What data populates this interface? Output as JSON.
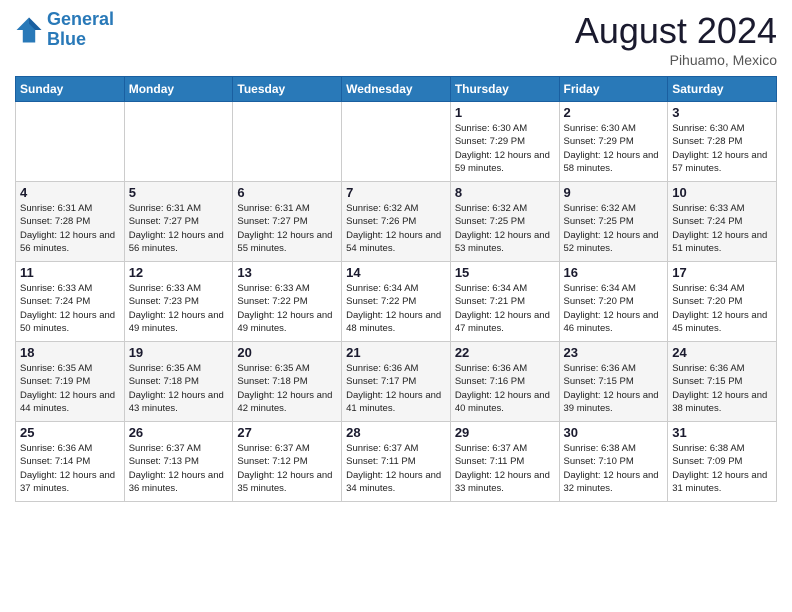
{
  "header": {
    "logo_line1": "General",
    "logo_line2": "Blue",
    "month_year": "August 2024",
    "location": "Pihuamo, Mexico"
  },
  "days_header": [
    "Sunday",
    "Monday",
    "Tuesday",
    "Wednesday",
    "Thursday",
    "Friday",
    "Saturday"
  ],
  "weeks": [
    [
      {
        "day": "",
        "sunrise": "",
        "sunset": "",
        "daylight": ""
      },
      {
        "day": "",
        "sunrise": "",
        "sunset": "",
        "daylight": ""
      },
      {
        "day": "",
        "sunrise": "",
        "sunset": "",
        "daylight": ""
      },
      {
        "day": "",
        "sunrise": "",
        "sunset": "",
        "daylight": ""
      },
      {
        "day": "1",
        "sunrise": "Sunrise: 6:30 AM",
        "sunset": "Sunset: 7:29 PM",
        "daylight": "Daylight: 12 hours and 59 minutes."
      },
      {
        "day": "2",
        "sunrise": "Sunrise: 6:30 AM",
        "sunset": "Sunset: 7:29 PM",
        "daylight": "Daylight: 12 hours and 58 minutes."
      },
      {
        "day": "3",
        "sunrise": "Sunrise: 6:30 AM",
        "sunset": "Sunset: 7:28 PM",
        "daylight": "Daylight: 12 hours and 57 minutes."
      }
    ],
    [
      {
        "day": "4",
        "sunrise": "Sunrise: 6:31 AM",
        "sunset": "Sunset: 7:28 PM",
        "daylight": "Daylight: 12 hours and 56 minutes."
      },
      {
        "day": "5",
        "sunrise": "Sunrise: 6:31 AM",
        "sunset": "Sunset: 7:27 PM",
        "daylight": "Daylight: 12 hours and 56 minutes."
      },
      {
        "day": "6",
        "sunrise": "Sunrise: 6:31 AM",
        "sunset": "Sunset: 7:27 PM",
        "daylight": "Daylight: 12 hours and 55 minutes."
      },
      {
        "day": "7",
        "sunrise": "Sunrise: 6:32 AM",
        "sunset": "Sunset: 7:26 PM",
        "daylight": "Daylight: 12 hours and 54 minutes."
      },
      {
        "day": "8",
        "sunrise": "Sunrise: 6:32 AM",
        "sunset": "Sunset: 7:25 PM",
        "daylight": "Daylight: 12 hours and 53 minutes."
      },
      {
        "day": "9",
        "sunrise": "Sunrise: 6:32 AM",
        "sunset": "Sunset: 7:25 PM",
        "daylight": "Daylight: 12 hours and 52 minutes."
      },
      {
        "day": "10",
        "sunrise": "Sunrise: 6:33 AM",
        "sunset": "Sunset: 7:24 PM",
        "daylight": "Daylight: 12 hours and 51 minutes."
      }
    ],
    [
      {
        "day": "11",
        "sunrise": "Sunrise: 6:33 AM",
        "sunset": "Sunset: 7:24 PM",
        "daylight": "Daylight: 12 hours and 50 minutes."
      },
      {
        "day": "12",
        "sunrise": "Sunrise: 6:33 AM",
        "sunset": "Sunset: 7:23 PM",
        "daylight": "Daylight: 12 hours and 49 minutes."
      },
      {
        "day": "13",
        "sunrise": "Sunrise: 6:33 AM",
        "sunset": "Sunset: 7:22 PM",
        "daylight": "Daylight: 12 hours and 49 minutes."
      },
      {
        "day": "14",
        "sunrise": "Sunrise: 6:34 AM",
        "sunset": "Sunset: 7:22 PM",
        "daylight": "Daylight: 12 hours and 48 minutes."
      },
      {
        "day": "15",
        "sunrise": "Sunrise: 6:34 AM",
        "sunset": "Sunset: 7:21 PM",
        "daylight": "Daylight: 12 hours and 47 minutes."
      },
      {
        "day": "16",
        "sunrise": "Sunrise: 6:34 AM",
        "sunset": "Sunset: 7:20 PM",
        "daylight": "Daylight: 12 hours and 46 minutes."
      },
      {
        "day": "17",
        "sunrise": "Sunrise: 6:34 AM",
        "sunset": "Sunset: 7:20 PM",
        "daylight": "Daylight: 12 hours and 45 minutes."
      }
    ],
    [
      {
        "day": "18",
        "sunrise": "Sunrise: 6:35 AM",
        "sunset": "Sunset: 7:19 PM",
        "daylight": "Daylight: 12 hours and 44 minutes."
      },
      {
        "day": "19",
        "sunrise": "Sunrise: 6:35 AM",
        "sunset": "Sunset: 7:18 PM",
        "daylight": "Daylight: 12 hours and 43 minutes."
      },
      {
        "day": "20",
        "sunrise": "Sunrise: 6:35 AM",
        "sunset": "Sunset: 7:18 PM",
        "daylight": "Daylight: 12 hours and 42 minutes."
      },
      {
        "day": "21",
        "sunrise": "Sunrise: 6:36 AM",
        "sunset": "Sunset: 7:17 PM",
        "daylight": "Daylight: 12 hours and 41 minutes."
      },
      {
        "day": "22",
        "sunrise": "Sunrise: 6:36 AM",
        "sunset": "Sunset: 7:16 PM",
        "daylight": "Daylight: 12 hours and 40 minutes."
      },
      {
        "day": "23",
        "sunrise": "Sunrise: 6:36 AM",
        "sunset": "Sunset: 7:15 PM",
        "daylight": "Daylight: 12 hours and 39 minutes."
      },
      {
        "day": "24",
        "sunrise": "Sunrise: 6:36 AM",
        "sunset": "Sunset: 7:15 PM",
        "daylight": "Daylight: 12 hours and 38 minutes."
      }
    ],
    [
      {
        "day": "25",
        "sunrise": "Sunrise: 6:36 AM",
        "sunset": "Sunset: 7:14 PM",
        "daylight": "Daylight: 12 hours and 37 minutes."
      },
      {
        "day": "26",
        "sunrise": "Sunrise: 6:37 AM",
        "sunset": "Sunset: 7:13 PM",
        "daylight": "Daylight: 12 hours and 36 minutes."
      },
      {
        "day": "27",
        "sunrise": "Sunrise: 6:37 AM",
        "sunset": "Sunset: 7:12 PM",
        "daylight": "Daylight: 12 hours and 35 minutes."
      },
      {
        "day": "28",
        "sunrise": "Sunrise: 6:37 AM",
        "sunset": "Sunset: 7:11 PM",
        "daylight": "Daylight: 12 hours and 34 minutes."
      },
      {
        "day": "29",
        "sunrise": "Sunrise: 6:37 AM",
        "sunset": "Sunset: 7:11 PM",
        "daylight": "Daylight: 12 hours and 33 minutes."
      },
      {
        "day": "30",
        "sunrise": "Sunrise: 6:38 AM",
        "sunset": "Sunset: 7:10 PM",
        "daylight": "Daylight: 12 hours and 32 minutes."
      },
      {
        "day": "31",
        "sunrise": "Sunrise: 6:38 AM",
        "sunset": "Sunset: 7:09 PM",
        "daylight": "Daylight: 12 hours and 31 minutes."
      }
    ]
  ]
}
